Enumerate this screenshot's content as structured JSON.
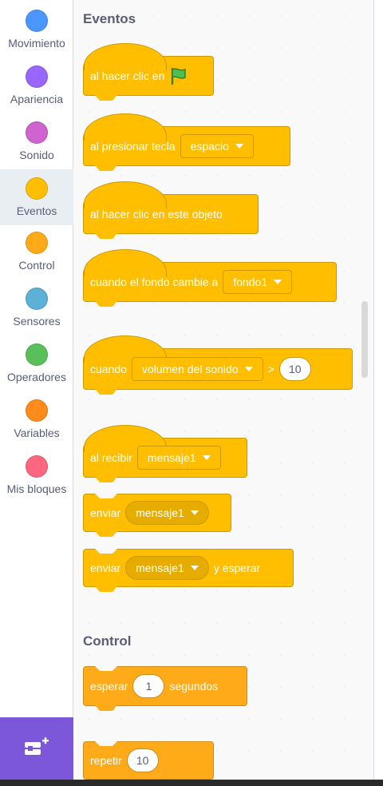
{
  "sidebar": {
    "categories": [
      {
        "label": "Movimiento",
        "color": "#4c97ff"
      },
      {
        "label": "Apariencia",
        "color": "#9966ff"
      },
      {
        "label": "Sonido",
        "color": "#cf63cf"
      },
      {
        "label": "Eventos",
        "color": "#ffbf00"
      },
      {
        "label": "Control",
        "color": "#ffab19"
      },
      {
        "label": "Sensores",
        "color": "#5cb1d6"
      },
      {
        "label": "Operadores",
        "color": "#59c059"
      },
      {
        "label": "Variables",
        "color": "#ff8c1a"
      },
      {
        "label": "Mis bloques",
        "color": "#ff6680"
      }
    ],
    "selected": "Eventos",
    "extension_icon": "add-extension-icon"
  },
  "workspace": {
    "events_title": "Eventos",
    "blocks": {
      "when_flag": {
        "text": "al hacer clic en",
        "icon": "green-flag-icon"
      },
      "when_key": {
        "text": "al presionar tecla",
        "dropdown": "espacio"
      },
      "when_sprite_clicked": {
        "text": "al hacer clic en este objeto"
      },
      "when_backdrop": {
        "text": "cuando el fondo cambie a",
        "dropdown": "fondo1"
      },
      "when_greater": {
        "text": "cuando",
        "dropdown": "volumen del sonido",
        "operator": ">",
        "value": "10"
      },
      "when_receive": {
        "text": "al recibir",
        "dropdown": "mensaje1"
      },
      "broadcast": {
        "text": "enviar",
        "dropdown": "mensaje1"
      },
      "broadcast_wait": {
        "text": "enviar",
        "dropdown": "mensaje1",
        "suffix": "y esperar"
      }
    },
    "control_title": "Control",
    "control_blocks": {
      "wait": {
        "text": "esperar",
        "value": "1",
        "suffix": "segundos"
      },
      "repeat": {
        "text": "repetir",
        "value": "10"
      }
    }
  },
  "colors": {
    "events": "#ffbf00",
    "control": "#ffab19",
    "extension_button": "#7d57d9"
  }
}
